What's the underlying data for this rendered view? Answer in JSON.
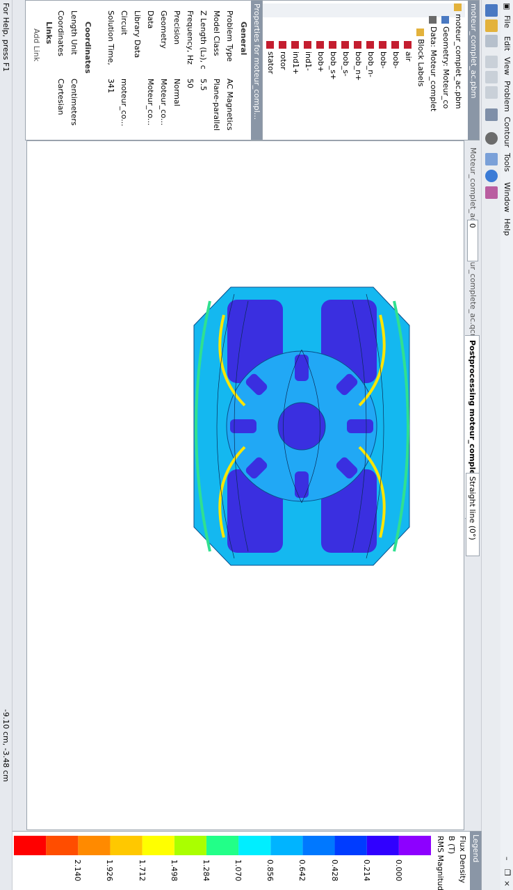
{
  "menu": [
    "File",
    "Edit",
    "View",
    "Problem",
    "Contour",
    "Tools",
    "Window",
    "Help"
  ],
  "tree": {
    "root": "moteur_complet_ac.pbm",
    "geometry": "Geometry: Moteur_co",
    "data": "Data: Moteur_complet",
    "block_labels": "Block Labels",
    "items": [
      "air",
      "bob-",
      "bob-",
      "bob_n-",
      "bob_n+",
      "bob_s-",
      "bob_s+",
      "bob+",
      "ind1-",
      "ind1+",
      "rotor",
      "stator"
    ]
  },
  "properties": {
    "title": "Properties for moteur_compl...",
    "general": "General",
    "rows": [
      {
        "k": "Problem Type",
        "v": "AC Magnetics"
      },
      {
        "k": "Model Class",
        "v": "Plane-parallel"
      },
      {
        "k": "Z Length (L₂), c",
        "v": "5.5"
      },
      {
        "k": "Frequency, Hz",
        "v": "50"
      },
      {
        "k": "Precision",
        "v": "Normal"
      },
      {
        "k": "Geometry",
        "v": "Moteur_co..."
      },
      {
        "k": "Data",
        "v": "Moteur_co..."
      },
      {
        "k": "Library Data",
        "v": ""
      },
      {
        "k": "Circuit",
        "v": "moteur_co..."
      },
      {
        "k": "Solution Time,",
        "v": "341"
      }
    ],
    "coordinates": "Coordinates",
    "coord_rows": [
      {
        "k": "Length Unit",
        "v": "Centimeters"
      },
      {
        "k": "Coordinates",
        "v": "Cartesian"
      }
    ],
    "links": "Links",
    "add_link": "Add Link"
  },
  "tabs": [
    "Moteur_complet_ac.mod",
    "moteur_complete_ac.qcr",
    "Postprocessing moteur_complet_ac.pbm"
  ],
  "toolbar_value": "0",
  "line_tool": "Straight line (0°)",
  "legend": {
    "title": "Legend",
    "q1": "Flux Density",
    "q2": "B (T)",
    "q3": "RMS Magnitude",
    "ticks": [
      "0.000",
      "0.214",
      "0.428",
      "0.642",
      "0.856",
      "1.070",
      "1.284",
      "1.498",
      "1.712",
      "1.926",
      "2.140"
    ],
    "colors": [
      "#8d00ff",
      "#3000ff",
      "#003cff",
      "#0078ff",
      "#00b4ff",
      "#00eeff",
      "#22ff88",
      "#aaff00",
      "#ffff00",
      "#ffc800",
      "#ff8a00",
      "#ff4d00",
      "#ff0000"
    ]
  },
  "status": {
    "help": "For Help, press F1",
    "coords": "-9.10 cm, -3.48 cm"
  }
}
